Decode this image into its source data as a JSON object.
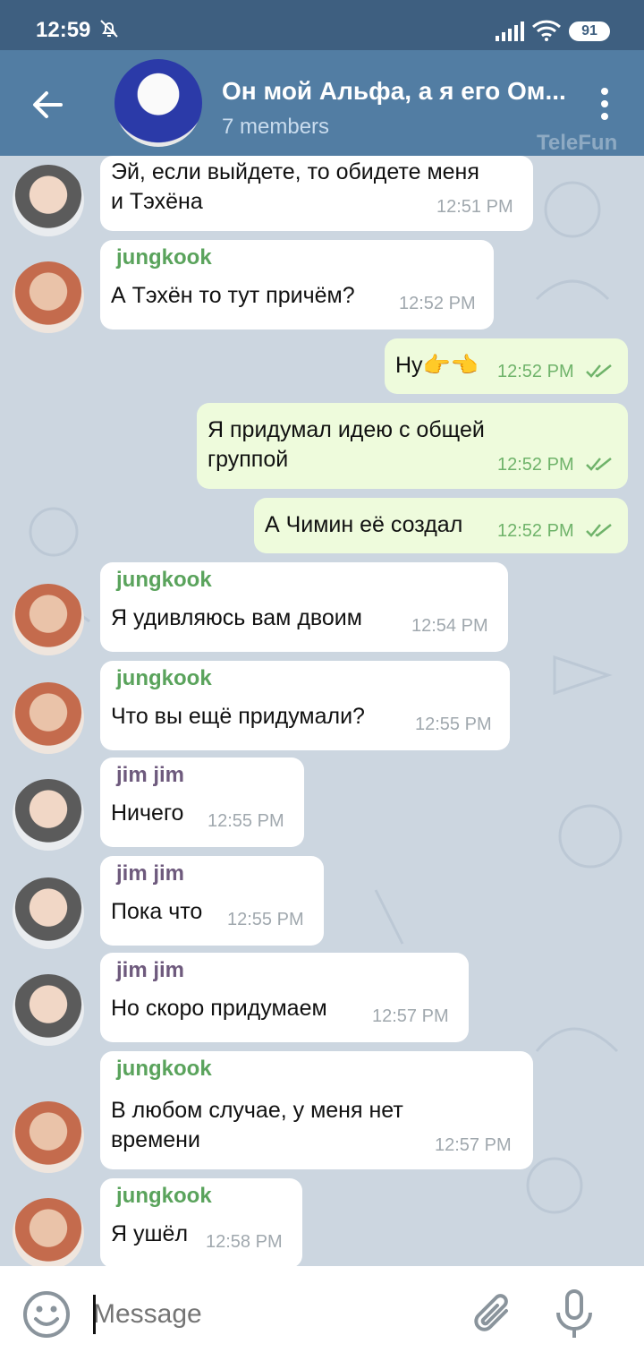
{
  "status_bar": {
    "time": "12:59",
    "battery": "91"
  },
  "header": {
    "title": "Он мой Альфа, а я его Ом...",
    "subtitle": "7 members",
    "watermark": "TeleFun"
  },
  "messages": [
    {
      "sender": "",
      "text_lines": [
        "Эй, если выйдете, то обидете меня",
        "и Тэхёна"
      ],
      "time": "12:51 PM"
    },
    {
      "sender": "jungkook",
      "text_lines": [
        "А Тэхён то тут причём?"
      ],
      "time": "12:52 PM"
    },
    {
      "sender": "",
      "text_lines": [
        "Ну👉👈"
      ],
      "time": "12:52 PM"
    },
    {
      "sender": "",
      "text_lines": [
        "Я придумал идею с общей",
        "группой"
      ],
      "time": "12:52 PM"
    },
    {
      "sender": "",
      "text_lines": [
        "А Чимин её создал"
      ],
      "time": "12:52 PM"
    },
    {
      "sender": "jungkook",
      "text_lines": [
        "Я удивляюсь вам двоим"
      ],
      "time": "12:54 PM"
    },
    {
      "sender": "jungkook",
      "text_lines": [
        "Что вы ещё придумали?"
      ],
      "time": "12:55 PM"
    },
    {
      "sender": "jim jim",
      "text_lines": [
        "Ничего"
      ],
      "time": "12:55 PM"
    },
    {
      "sender": "jim jim",
      "text_lines": [
        "Пока что"
      ],
      "time": "12:55 PM"
    },
    {
      "sender": "jim jim",
      "text_lines": [
        "Но скоро придумаем"
      ],
      "time": "12:57 PM"
    },
    {
      "sender": "jungkook",
      "text_lines": [
        "В любом случае, у меня нет",
        "времени"
      ],
      "time": "12:57 PM"
    },
    {
      "sender": "jungkook",
      "text_lines": [
        "Я ушёл"
      ],
      "time": "12:58 PM"
    }
  ],
  "input": {
    "placeholder": "Message"
  },
  "icons": {
    "back": "arrow-left-icon",
    "more": "more-vertical-icon",
    "emoji": "smiley-icon",
    "attach": "paperclip-icon",
    "mic": "microphone-icon",
    "read": "double-check-icon",
    "mute": "bell-off-icon"
  },
  "colors": {
    "header": "#527da3",
    "status_bar": "#3e5f80",
    "outgoing_bubble": "#eefbdc",
    "incoming_bubble": "#ffffff",
    "sender_jungkook": "#5aa35c",
    "sender_jim": "#6e5a7d",
    "read_check": "#6fb36a"
  }
}
